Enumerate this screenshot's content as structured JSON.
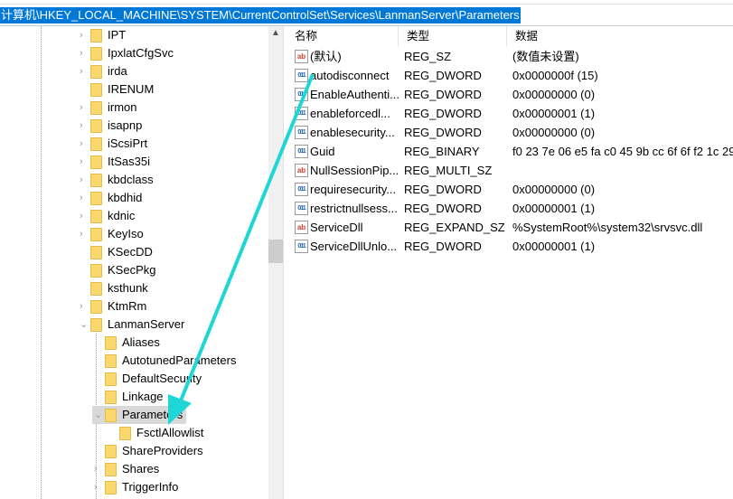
{
  "address_bar": "计算机\\HKEY_LOCAL_MACHINE\\SYSTEM\\CurrentControlSet\\Services\\LanmanServer\\Parameters",
  "tree": [
    {
      "label": "IPT",
      "level": 1,
      "expander": "collapsed"
    },
    {
      "label": "IpxlatCfgSvc",
      "level": 1,
      "expander": "collapsed"
    },
    {
      "label": "irda",
      "level": 1,
      "expander": "collapsed"
    },
    {
      "label": "IRENUM",
      "level": 1,
      "expander": "none"
    },
    {
      "label": "irmon",
      "level": 1,
      "expander": "collapsed"
    },
    {
      "label": "isapnp",
      "level": 1,
      "expander": "collapsed"
    },
    {
      "label": "iScsiPrt",
      "level": 1,
      "expander": "collapsed"
    },
    {
      "label": "ItSas35i",
      "level": 1,
      "expander": "collapsed"
    },
    {
      "label": "kbdclass",
      "level": 1,
      "expander": "collapsed"
    },
    {
      "label": "kbdhid",
      "level": 1,
      "expander": "collapsed"
    },
    {
      "label": "kdnic",
      "level": 1,
      "expander": "collapsed"
    },
    {
      "label": "KeyIso",
      "level": 1,
      "expander": "collapsed"
    },
    {
      "label": "KSecDD",
      "level": 1,
      "expander": "none"
    },
    {
      "label": "KSecPkg",
      "level": 1,
      "expander": "none"
    },
    {
      "label": "ksthunk",
      "level": 1,
      "expander": "none"
    },
    {
      "label": "KtmRm",
      "level": 1,
      "expander": "collapsed"
    },
    {
      "label": "LanmanServer",
      "level": 1,
      "expander": "expanded"
    },
    {
      "label": "Aliases",
      "level": 2,
      "expander": "none"
    },
    {
      "label": "AutotunedParameters",
      "level": 2,
      "expander": "none"
    },
    {
      "label": "DefaultSecurity",
      "level": 2,
      "expander": "none"
    },
    {
      "label": "Linkage",
      "level": 2,
      "expander": "none"
    },
    {
      "label": "Parameters",
      "level": 2,
      "expander": "expanded",
      "selected": true
    },
    {
      "label": "FsctlAllowlist",
      "level": 3,
      "expander": "none"
    },
    {
      "label": "ShareProviders",
      "level": 2,
      "expander": "none"
    },
    {
      "label": "Shares",
      "level": 2,
      "expander": "collapsed"
    },
    {
      "label": "TriggerInfo",
      "level": 2,
      "expander": "collapsed"
    }
  ],
  "columns": {
    "name": "名称",
    "type": "类型",
    "data": "数据"
  },
  "values": [
    {
      "icon": "string-value-icon",
      "name": "(默认)",
      "type": "REG_SZ",
      "data": "(数值未设置)"
    },
    {
      "icon": "binary-value-icon",
      "name": "autodisconnect",
      "type": "REG_DWORD",
      "data": "0x0000000f (15)"
    },
    {
      "icon": "binary-value-icon",
      "name": "EnableAuthenti...",
      "type": "REG_DWORD",
      "data": "0x00000000 (0)"
    },
    {
      "icon": "binary-value-icon",
      "name": "enableforcedl...",
      "type": "REG_DWORD",
      "data": "0x00000001 (1)"
    },
    {
      "icon": "binary-value-icon",
      "name": "enablesecurity...",
      "type": "REG_DWORD",
      "data": "0x00000000 (0)"
    },
    {
      "icon": "binary-value-icon",
      "name": "Guid",
      "type": "REG_BINARY",
      "data": "f0 23 7e 06 e5 fa c0 45 9b cc 6f 6f f2 1c 29"
    },
    {
      "icon": "string-value-icon",
      "name": "NullSessionPip...",
      "type": "REG_MULTI_SZ",
      "data": ""
    },
    {
      "icon": "binary-value-icon",
      "name": "requiresecurity...",
      "type": "REG_DWORD",
      "data": "0x00000000 (0)"
    },
    {
      "icon": "binary-value-icon",
      "name": "restrictnullsess...",
      "type": "REG_DWORD",
      "data": "0x00000001 (1)"
    },
    {
      "icon": "string-value-icon",
      "name": "ServiceDll",
      "type": "REG_EXPAND_SZ",
      "data": "%SystemRoot%\\system32\\srvsvc.dll"
    },
    {
      "icon": "binary-value-icon",
      "name": "ServiceDllUnlo...",
      "type": "REG_DWORD",
      "data": "0x00000001 (1)"
    }
  ],
  "colors": {
    "selection": "#0078d7",
    "annotation_arrow": "#1fd6d6",
    "folder": "#fbd86c"
  }
}
